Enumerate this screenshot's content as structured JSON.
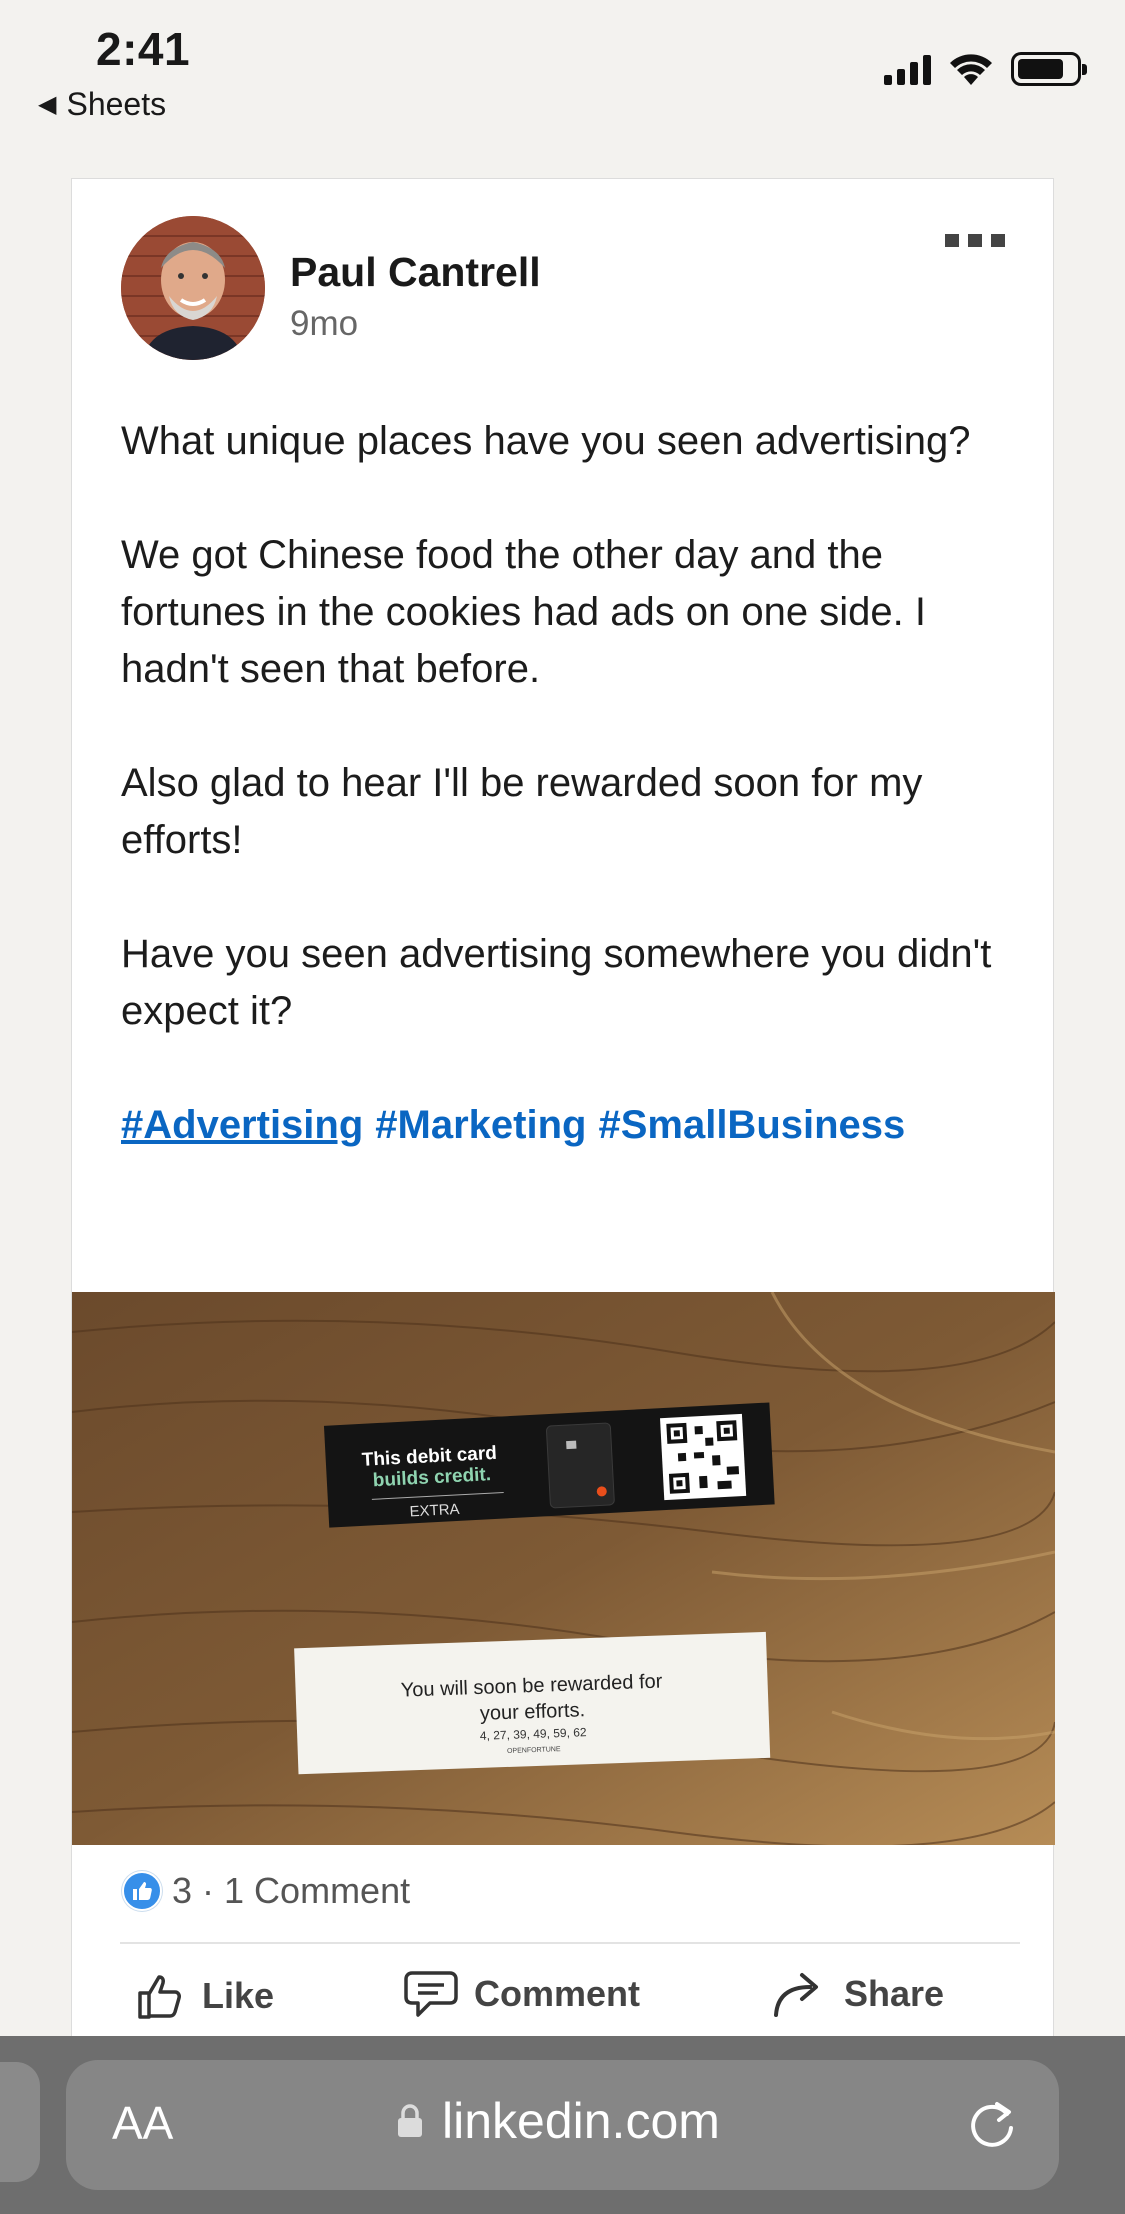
{
  "status_bar": {
    "time": "2:41",
    "back_app": "Sheets"
  },
  "post": {
    "author": "Paul Cantrell",
    "time_ago": "9mo",
    "paragraphs": [
      "What unique places have you seen advertising?",
      "We got Chinese food the other day and the fortunes in the cookies had ads on one side. I hadn't seen that before.",
      "Also glad to hear I'll be rewarded soon for my efforts!",
      "Have you seen advertising somewhere you didn't expect it?"
    ],
    "hashtags": [
      "#Advertising",
      "#Marketing",
      "#SmallBusiness"
    ],
    "image": {
      "ad_line1": "This debit card",
      "ad_line2": "builds credit.",
      "ad_brand": "EXTRA",
      "fortune_line1": "You will soon be rewarded for",
      "fortune_line2": "your efforts.",
      "fortune_numbers": "4, 27, 39, 49, 59, 62",
      "fortune_brand": "OPENFORTUNE"
    },
    "reaction_count": "3",
    "separator": "·",
    "comments": "1 Comment"
  },
  "actions": {
    "like": "Like",
    "comment": "Comment",
    "share": "Share"
  },
  "browser": {
    "text_size": "AA",
    "url": "linkedin.com"
  },
  "colors": {
    "link": "#0a66c2",
    "like_badge": "#378fe9",
    "browser_bar": "#6e6e6e"
  }
}
